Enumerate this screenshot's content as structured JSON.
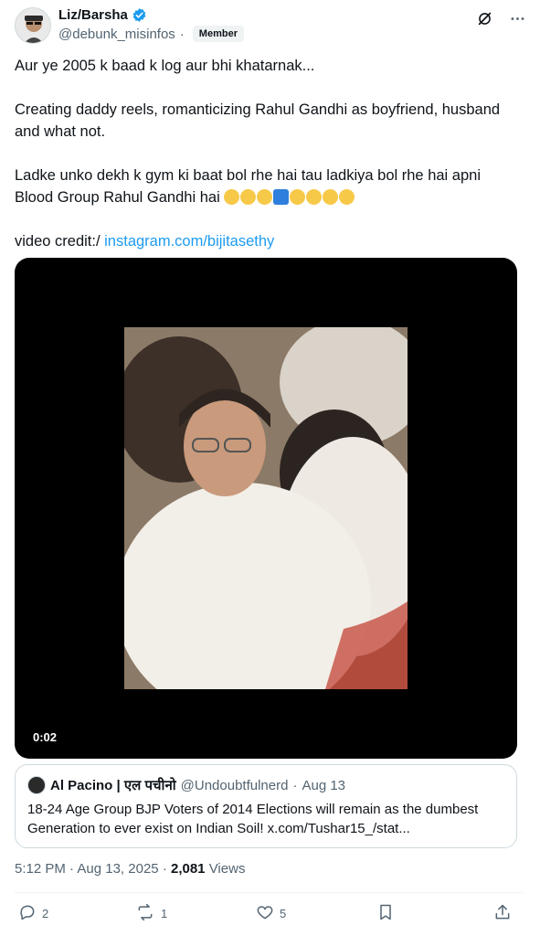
{
  "author": {
    "display_name": "Liz/Barsha",
    "handle": "@debunk_misinfos",
    "separator": "·",
    "badge": "Member"
  },
  "tweet": {
    "paragraphs": [
      "Aur ye 2005 k baad k log aur bhi khatarnak...",
      "Creating daddy reels, romanticizing Rahul Gandhi as boyfriend, husband and what not.",
      "Ladke unko dekh k gym ki baat bol rhe hai tau ladkiya bol rhe hai apni Blood Group Rahul Gandhi hai"
    ],
    "credit_prefix": "video credit:/ ",
    "credit_link": "instagram.com/bijitasethy"
  },
  "video": {
    "timecode": "0:02"
  },
  "quote": {
    "name": "Al Pacino | एल पचीनो",
    "handle": "@Undoubtfulnerd",
    "dot": "·",
    "date": "Aug 13",
    "text": "18-24 Age Group BJP Voters of 2014 Elections will remain as the dumbest Generation to ever exist on Indian Soil! x.com/Tushar15_/stat..."
  },
  "meta": {
    "time": "5:12 PM",
    "date": "Aug 13, 2025",
    "views_count": "2,081",
    "views_label": "Views",
    "dot": "·"
  },
  "actions": {
    "replies": "2",
    "reposts": "1",
    "likes": "5"
  },
  "colors": {
    "accent": "#1d9bf0",
    "secondary_text": "#536471",
    "border": "#cfd9de"
  },
  "icons": [
    "verified-icon",
    "grok-icon",
    "more-icon",
    "reply-icon",
    "repost-icon",
    "like-icon",
    "bookmark-icon",
    "share-icon"
  ]
}
